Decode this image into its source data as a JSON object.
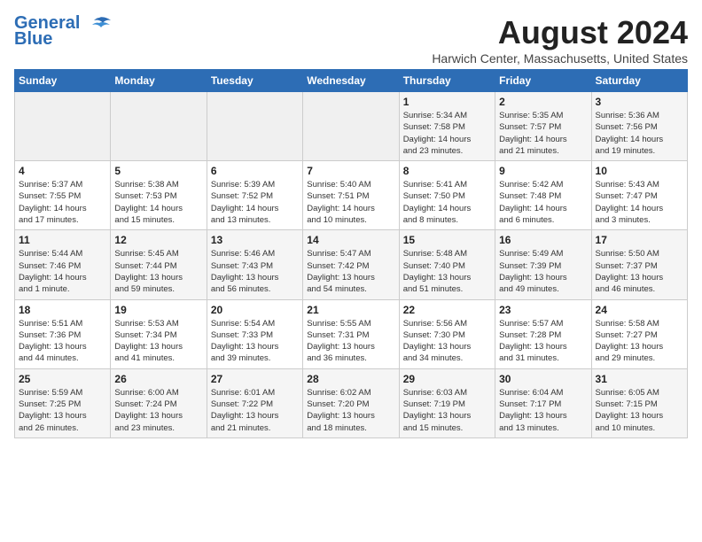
{
  "header": {
    "logo_line1": "General",
    "logo_line2": "Blue",
    "month_year": "August 2024",
    "location": "Harwich Center, Massachusetts, United States"
  },
  "weekdays": [
    "Sunday",
    "Monday",
    "Tuesday",
    "Wednesday",
    "Thursday",
    "Friday",
    "Saturday"
  ],
  "weeks": [
    [
      {
        "day": "",
        "content": ""
      },
      {
        "day": "",
        "content": ""
      },
      {
        "day": "",
        "content": ""
      },
      {
        "day": "",
        "content": ""
      },
      {
        "day": "1",
        "content": "Sunrise: 5:34 AM\nSunset: 7:58 PM\nDaylight: 14 hours\nand 23 minutes."
      },
      {
        "day": "2",
        "content": "Sunrise: 5:35 AM\nSunset: 7:57 PM\nDaylight: 14 hours\nand 21 minutes."
      },
      {
        "day": "3",
        "content": "Sunrise: 5:36 AM\nSunset: 7:56 PM\nDaylight: 14 hours\nand 19 minutes."
      }
    ],
    [
      {
        "day": "4",
        "content": "Sunrise: 5:37 AM\nSunset: 7:55 PM\nDaylight: 14 hours\nand 17 minutes."
      },
      {
        "day": "5",
        "content": "Sunrise: 5:38 AM\nSunset: 7:53 PM\nDaylight: 14 hours\nand 15 minutes."
      },
      {
        "day": "6",
        "content": "Sunrise: 5:39 AM\nSunset: 7:52 PM\nDaylight: 14 hours\nand 13 minutes."
      },
      {
        "day": "7",
        "content": "Sunrise: 5:40 AM\nSunset: 7:51 PM\nDaylight: 14 hours\nand 10 minutes."
      },
      {
        "day": "8",
        "content": "Sunrise: 5:41 AM\nSunset: 7:50 PM\nDaylight: 14 hours\nand 8 minutes."
      },
      {
        "day": "9",
        "content": "Sunrise: 5:42 AM\nSunset: 7:48 PM\nDaylight: 14 hours\nand 6 minutes."
      },
      {
        "day": "10",
        "content": "Sunrise: 5:43 AM\nSunset: 7:47 PM\nDaylight: 14 hours\nand 3 minutes."
      }
    ],
    [
      {
        "day": "11",
        "content": "Sunrise: 5:44 AM\nSunset: 7:46 PM\nDaylight: 14 hours\nand 1 minute."
      },
      {
        "day": "12",
        "content": "Sunrise: 5:45 AM\nSunset: 7:44 PM\nDaylight: 13 hours\nand 59 minutes."
      },
      {
        "day": "13",
        "content": "Sunrise: 5:46 AM\nSunset: 7:43 PM\nDaylight: 13 hours\nand 56 minutes."
      },
      {
        "day": "14",
        "content": "Sunrise: 5:47 AM\nSunset: 7:42 PM\nDaylight: 13 hours\nand 54 minutes."
      },
      {
        "day": "15",
        "content": "Sunrise: 5:48 AM\nSunset: 7:40 PM\nDaylight: 13 hours\nand 51 minutes."
      },
      {
        "day": "16",
        "content": "Sunrise: 5:49 AM\nSunset: 7:39 PM\nDaylight: 13 hours\nand 49 minutes."
      },
      {
        "day": "17",
        "content": "Sunrise: 5:50 AM\nSunset: 7:37 PM\nDaylight: 13 hours\nand 46 minutes."
      }
    ],
    [
      {
        "day": "18",
        "content": "Sunrise: 5:51 AM\nSunset: 7:36 PM\nDaylight: 13 hours\nand 44 minutes."
      },
      {
        "day": "19",
        "content": "Sunrise: 5:53 AM\nSunset: 7:34 PM\nDaylight: 13 hours\nand 41 minutes."
      },
      {
        "day": "20",
        "content": "Sunrise: 5:54 AM\nSunset: 7:33 PM\nDaylight: 13 hours\nand 39 minutes."
      },
      {
        "day": "21",
        "content": "Sunrise: 5:55 AM\nSunset: 7:31 PM\nDaylight: 13 hours\nand 36 minutes."
      },
      {
        "day": "22",
        "content": "Sunrise: 5:56 AM\nSunset: 7:30 PM\nDaylight: 13 hours\nand 34 minutes."
      },
      {
        "day": "23",
        "content": "Sunrise: 5:57 AM\nSunset: 7:28 PM\nDaylight: 13 hours\nand 31 minutes."
      },
      {
        "day": "24",
        "content": "Sunrise: 5:58 AM\nSunset: 7:27 PM\nDaylight: 13 hours\nand 29 minutes."
      }
    ],
    [
      {
        "day": "25",
        "content": "Sunrise: 5:59 AM\nSunset: 7:25 PM\nDaylight: 13 hours\nand 26 minutes."
      },
      {
        "day": "26",
        "content": "Sunrise: 6:00 AM\nSunset: 7:24 PM\nDaylight: 13 hours\nand 23 minutes."
      },
      {
        "day": "27",
        "content": "Sunrise: 6:01 AM\nSunset: 7:22 PM\nDaylight: 13 hours\nand 21 minutes."
      },
      {
        "day": "28",
        "content": "Sunrise: 6:02 AM\nSunset: 7:20 PM\nDaylight: 13 hours\nand 18 minutes."
      },
      {
        "day": "29",
        "content": "Sunrise: 6:03 AM\nSunset: 7:19 PM\nDaylight: 13 hours\nand 15 minutes."
      },
      {
        "day": "30",
        "content": "Sunrise: 6:04 AM\nSunset: 7:17 PM\nDaylight: 13 hours\nand 13 minutes."
      },
      {
        "day": "31",
        "content": "Sunrise: 6:05 AM\nSunset: 7:15 PM\nDaylight: 13 hours\nand 10 minutes."
      }
    ]
  ]
}
